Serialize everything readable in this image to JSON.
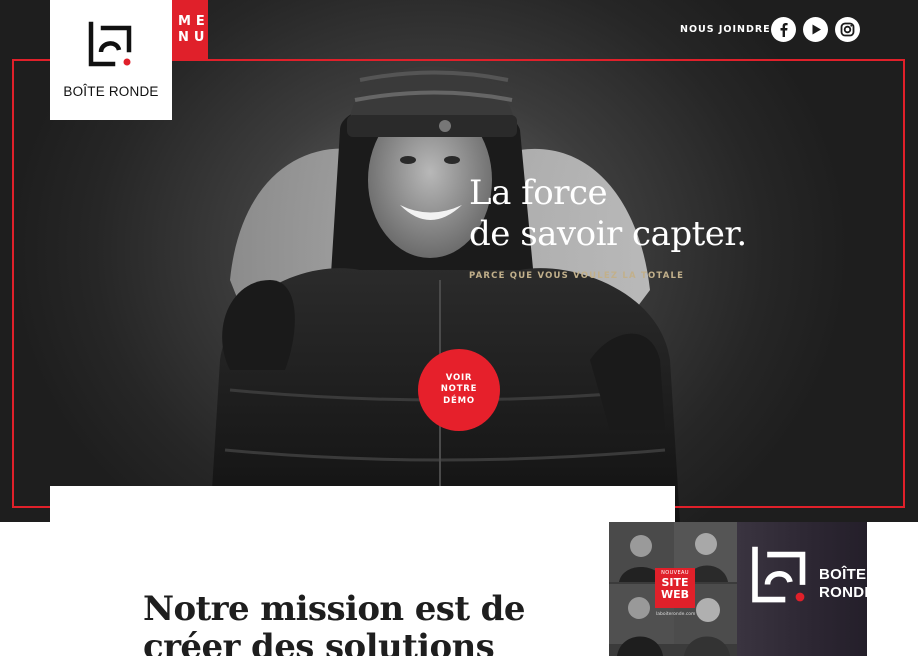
{
  "brand": {
    "name": "BOÎTE RONDE",
    "accent": "#e0202a"
  },
  "menu": {
    "line1": "ME",
    "line2": "NU"
  },
  "nav": {
    "contact_label": "NOUS JOINDRE",
    "social": [
      "facebook-icon",
      "youtube-icon",
      "instagram-icon"
    ]
  },
  "hero": {
    "headline_line1": "La force",
    "headline_line2": "de savoir capter.",
    "subline": "PARCE QUE VOUS VOULEZ LA TOTALE",
    "cta": "VOIR\nNOTRE\nDÉMO"
  },
  "mission": {
    "heading": "Notre mission est de créer des solutions"
  },
  "video": {
    "badge_small": "NOUVEAU",
    "badge_line1": "SITE",
    "badge_line2": "WEB",
    "url": "laboiteronde.com",
    "logo_line1": "BOÎTE",
    "logo_line2": "RONDE"
  }
}
